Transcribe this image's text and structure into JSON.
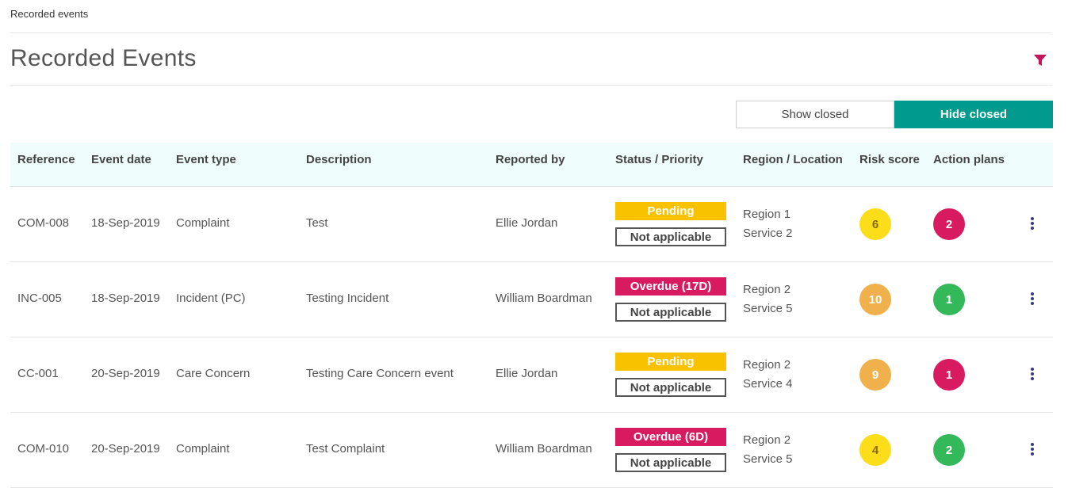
{
  "breadcrumb": "Recorded events",
  "title": "Recorded Events",
  "toggle": {
    "show_label": "Show closed",
    "hide_label": "Hide closed"
  },
  "colors": {
    "accent": "#009a8f",
    "filter": "#c2185b",
    "pending": "#f8c200",
    "overdue": "#d81b60",
    "header_bg": "#f0fdfd"
  },
  "columns": [
    "Reference",
    "Event date",
    "Event type",
    "Description",
    "Reported by",
    "Status / Priority",
    "Region / Location",
    "Risk score",
    "Action plans"
  ],
  "rows": [
    {
      "reference": "COM-008",
      "date": "18-Sep-2019",
      "type": "Complaint",
      "description": "Test",
      "reported_by": "Ellie Jordan",
      "status": "Pending",
      "status_kind": "pending",
      "priority": "Not applicable",
      "region": "Region 1",
      "location": "Service 2",
      "risk": "6",
      "risk_color": "#fbdd1a",
      "risk_text": "#8a6a00",
      "actions": "2",
      "actions_color": "#d81b60"
    },
    {
      "reference": "INC-005",
      "date": "18-Sep-2019",
      "type": "Incident (PC)",
      "description": "Testing Incident",
      "reported_by": "William Boardman",
      "status": "Overdue (17D)",
      "status_kind": "overdue",
      "priority": "Not applicable",
      "region": "Region 2",
      "location": "Service 5",
      "risk": "10",
      "risk_color": "#f0b04c",
      "risk_text": "#ffffff",
      "actions": "1",
      "actions_color": "#33b85a"
    },
    {
      "reference": "CC-001",
      "date": "20-Sep-2019",
      "type": "Care Concern",
      "description": "Testing Care Concern event",
      "reported_by": "Ellie Jordan",
      "status": "Pending",
      "status_kind": "pending",
      "priority": "Not applicable",
      "region": "Region 2",
      "location": "Service 4",
      "risk": "9",
      "risk_color": "#f0b04c",
      "risk_text": "#ffffff",
      "actions": "1",
      "actions_color": "#d81b60"
    },
    {
      "reference": "COM-010",
      "date": "20-Sep-2019",
      "type": "Complaint",
      "description": "Test Complaint",
      "reported_by": "William Boardman",
      "status": "Overdue (6D)",
      "status_kind": "overdue",
      "priority": "Not applicable",
      "region": "Region 2",
      "location": "Service 5",
      "risk": "4",
      "risk_color": "#fbdd1a",
      "risk_text": "#8a6a00",
      "actions": "2",
      "actions_color": "#33b85a"
    }
  ]
}
